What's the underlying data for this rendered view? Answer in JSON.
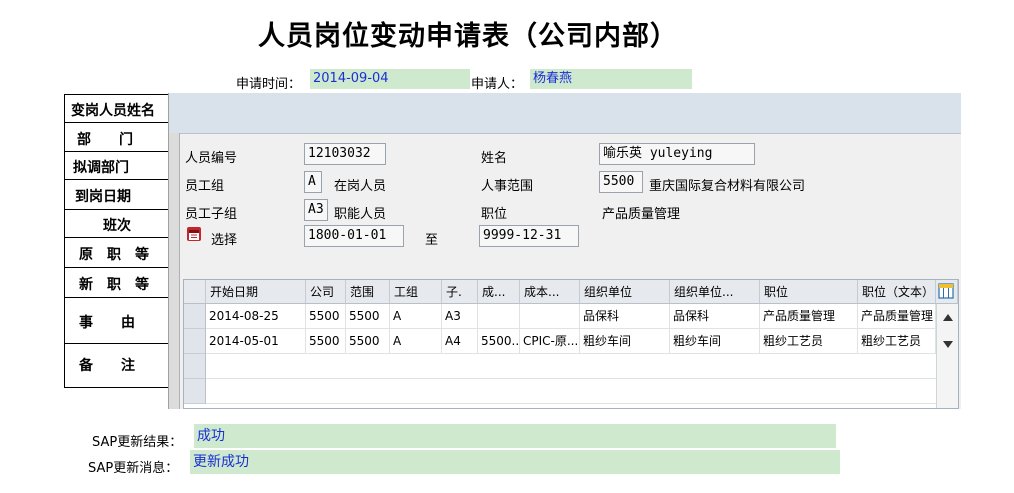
{
  "title": "人员岗位变动申请表（公司内部）",
  "request": {
    "time_label": "申请时间：",
    "time_value": "2014-09-04",
    "applicant_label": "申请人：",
    "applicant_value": "杨春燕"
  },
  "form_rows": [
    "变岗人员姓名",
    "部　　门",
    "拟调部门",
    "到岗日期",
    "班次",
    "原　职　等",
    "新　职　等",
    "事　　由",
    "备　　注"
  ],
  "sap": {
    "person_no_label": "人员编号",
    "person_no_value": "12103032",
    "name_label": "姓名",
    "name_value": "喻乐英 yuleying",
    "emp_group_label": "员工组",
    "emp_group_code": "A",
    "emp_group_text": "在岗人员",
    "pers_area_label": "人事范围",
    "pers_area_code": "5500",
    "pers_area_text": "重庆国际复合材料有限公司",
    "emp_subgroup_label": "员工子组",
    "emp_subgroup_code": "A3",
    "emp_subgroup_text": "职能人员",
    "position_label": "职位",
    "position_value": "产品质量管理",
    "select_label": "选择",
    "date_from": "1800-01-01",
    "to_label": "至",
    "date_to": "9999-12-31"
  },
  "grid": {
    "columns": [
      "开始日期",
      "公司",
      "范围",
      "工组",
      "子.",
      "成...",
      "成本...",
      "组织单位",
      "组织单位...",
      "职位",
      "职位（文本）"
    ],
    "rows": [
      [
        "2014-08-25",
        "5500",
        "5500",
        "A",
        "A3",
        "",
        "",
        "品保科",
        "品保科",
        "产品质量管理",
        "产品质量管理"
      ],
      [
        "2014-05-01",
        "5500",
        "5500",
        "A",
        "A4",
        "5500...",
        "CPIC-原...",
        "粗纱车间",
        "粗纱车间",
        "粗纱工艺员",
        "粗纱工艺员"
      ]
    ]
  },
  "result": {
    "status_label": "SAP更新结果：",
    "status_value": "成功",
    "message_label": "SAP更新消息：",
    "message_value": "更新成功"
  },
  "colors": {
    "field_bg": "#cfe9cf",
    "field_text": "#1a2fd6",
    "sap_header": "#d9e2ea"
  }
}
